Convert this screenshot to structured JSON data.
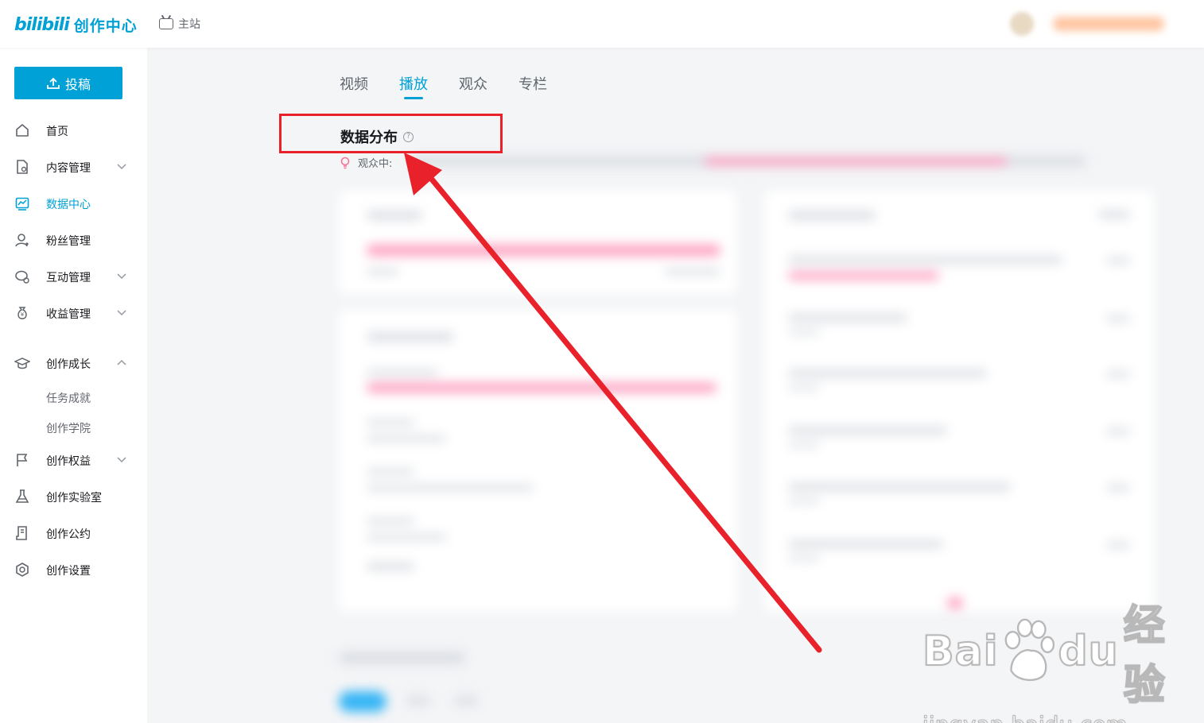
{
  "header": {
    "logo_bili": "bilibili",
    "logo_title": "创作中心",
    "home_link": "主站"
  },
  "sidebar": {
    "upload_label": "投稿",
    "items": [
      {
        "label": "首页",
        "icon": "home-icon"
      },
      {
        "label": "内容管理",
        "icon": "document-icon"
      },
      {
        "label": "数据中心",
        "icon": "chart-icon",
        "active": true
      },
      {
        "label": "粉丝管理",
        "icon": "user-icon"
      },
      {
        "label": "互动管理",
        "icon": "chat-icon"
      },
      {
        "label": "收益管理",
        "icon": "money-bag-icon"
      },
      {
        "label": "创作成长",
        "icon": "graduation-cap-icon"
      },
      {
        "label": "创作权益",
        "icon": "flag-icon"
      },
      {
        "label": "创作实验室",
        "icon": "flask-icon"
      },
      {
        "label": "创作公约",
        "icon": "scroll-icon"
      },
      {
        "label": "创作设置",
        "icon": "settings-icon"
      }
    ],
    "sub_items": [
      "任务成就",
      "创作学院"
    ]
  },
  "main": {
    "tabs": [
      "视频",
      "播放",
      "观众",
      "专栏"
    ],
    "active_tab": "播放",
    "section_title": "数据分布",
    "hint_prefix": "观众中:"
  },
  "colors": {
    "accent": "#00a1d6",
    "annotation": "#e8212b"
  },
  "watermark": {
    "brand": "Bai",
    "brand_suffix": "du",
    "brand_cn": "经验",
    "url": "jingyan.baidu.com"
  }
}
